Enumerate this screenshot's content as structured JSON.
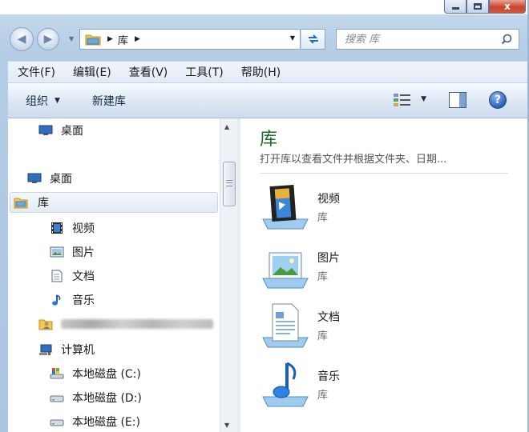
{
  "window": {
    "close_glyph": "x"
  },
  "address": {
    "crumbs": [
      "库"
    ],
    "search_placeholder": "搜索 库"
  },
  "menu": {
    "items": [
      "文件(F)",
      "编辑(E)",
      "查看(V)",
      "工具(T)",
      "帮助(H)"
    ]
  },
  "toolbar": {
    "organize_label": "组织",
    "new_library_label": "新建库",
    "help_glyph": "?"
  },
  "nav": {
    "items": [
      {
        "label": "桌面",
        "icon": "desktop-icon"
      },
      {
        "label": "桌面",
        "icon": "desktop-icon"
      },
      {
        "label": "库",
        "icon": "library-folder-icon",
        "selected": true
      },
      {
        "label": "视频",
        "icon": "video-icon"
      },
      {
        "label": "图片",
        "icon": "picture-icon"
      },
      {
        "label": "文档",
        "icon": "document-icon"
      },
      {
        "label": "音乐",
        "icon": "music-icon"
      },
      {
        "label": "",
        "icon": "user-folder-icon",
        "blurred": true
      },
      {
        "label": "计算机",
        "icon": "computer-icon"
      },
      {
        "label": "本地磁盘 (C:)",
        "icon": "system-drive-icon"
      },
      {
        "label": "本地磁盘 (D:)",
        "icon": "drive-icon"
      },
      {
        "label": "本地磁盘 (E:)",
        "icon": "drive-icon"
      }
    ]
  },
  "content": {
    "title": "库",
    "subtitle": "打开库以查看文件并根据文件夹、日期...",
    "libraries": [
      {
        "name": "视频",
        "type": "库",
        "icon": "video-library-icon"
      },
      {
        "name": "图片",
        "type": "库",
        "icon": "picture-library-icon"
      },
      {
        "name": "文档",
        "type": "库",
        "icon": "document-library-icon"
      },
      {
        "name": "音乐",
        "type": "库",
        "icon": "music-library-icon"
      }
    ]
  },
  "colors": {
    "title_green": "#1f6b2f",
    "selection": "#e4ebf4",
    "frame": "#b6cde6"
  }
}
